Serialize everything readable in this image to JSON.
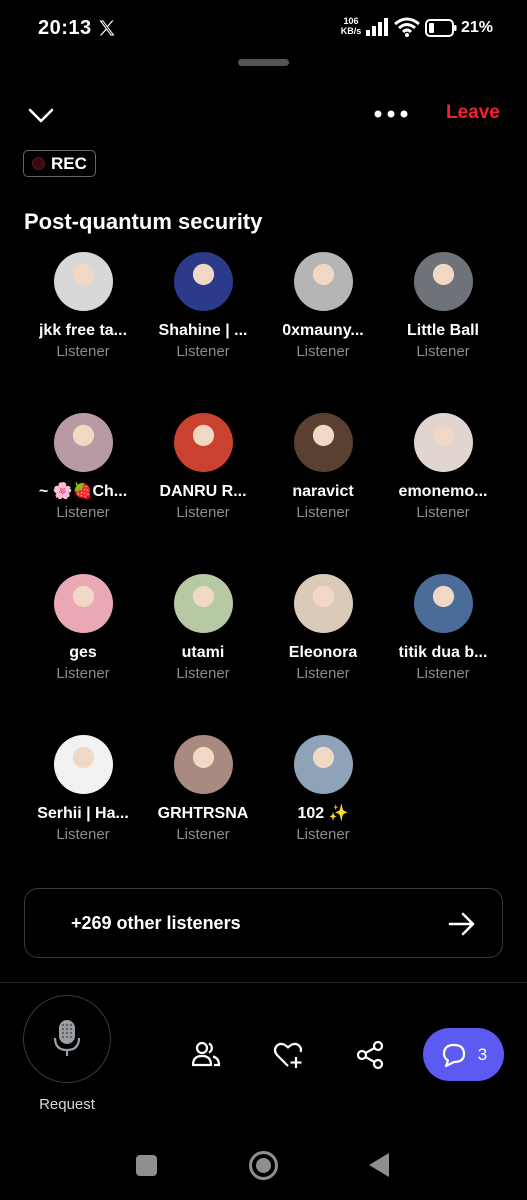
{
  "status_bar": {
    "time": "20:13",
    "net_speed_value": "106",
    "net_speed_unit": "KB/s",
    "battery_percent": "21%",
    "icons": [
      "x-logo-icon",
      "signal-icon",
      "wifi-icon",
      "battery-icon"
    ]
  },
  "header": {
    "leave_label": "Leave",
    "leave_color": "#f4212e",
    "rec_label": "REC"
  },
  "space": {
    "title": "Post-quantum security"
  },
  "listeners": [
    {
      "name": "jkk free ta...",
      "role": "Listener",
      "avatar_color": "#d8d8d8"
    },
    {
      "name": "Shahine | ...",
      "role": "Listener",
      "avatar_color": "#2b3b8a"
    },
    {
      "name": "0xmauny...",
      "role": "Listener",
      "avatar_color": "#b5b5b5"
    },
    {
      "name": "Little Ball",
      "role": "Listener",
      "avatar_color": "#6e737a"
    },
    {
      "name": "~ 🌸🍓Ch...",
      "role": "Listener",
      "avatar_color": "#b89aa2"
    },
    {
      "name": "DANRU R...",
      "role": "Listener",
      "avatar_color": "#c9412f"
    },
    {
      "name": "naravict",
      "role": "Listener",
      "avatar_color": "#5a4030"
    },
    {
      "name": "emonemo...",
      "role": "Listener",
      "avatar_color": "#e2d4cf"
    },
    {
      "name": "ges",
      "role": "Listener",
      "avatar_color": "#e8a9b5"
    },
    {
      "name": "utami",
      "role": "Listener",
      "avatar_color": "#b7c8a4"
    },
    {
      "name": "Eleonora",
      "role": "Listener",
      "avatar_color": "#d9cbb8"
    },
    {
      "name": "titik dua b...",
      "role": "Listener",
      "avatar_color": "#4b6c98"
    },
    {
      "name": "Serhii | Ha...",
      "role": "Listener",
      "avatar_color": "#f2f2f2"
    },
    {
      "name": "GRHTRSNA",
      "role": "Listener",
      "avatar_color": "#a88a80"
    },
    {
      "name": "102 ✨",
      "role": "Listener",
      "avatar_color": "#8fa3b8"
    }
  ],
  "other_listeners": {
    "label": "+269 other listeners"
  },
  "toolbar": {
    "request_label": "Request",
    "chat_count": "3",
    "chat_color": "#5b5bf2",
    "icons": [
      "people-icon",
      "heart-plus-icon",
      "share-icon",
      "chat-icon"
    ]
  }
}
